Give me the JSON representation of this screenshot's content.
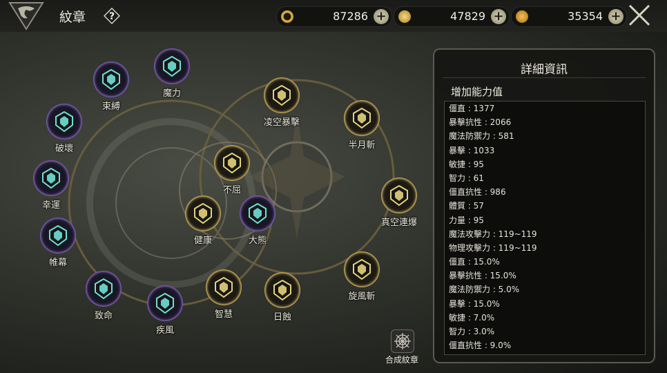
{
  "header": {
    "title": "紋章",
    "help_icon": "question-icon",
    "currencies": [
      {
        "name": "refresh-currency",
        "icon": "cycle-coin-icon",
        "value": "87286"
      },
      {
        "name": "gold-currency",
        "icon": "gold-coin-icon",
        "value": "47829"
      },
      {
        "name": "bronze-currency",
        "icon": "bronze-coin-icon",
        "value": "35354"
      }
    ],
    "close_icon": "crossed-swords-icon"
  },
  "emblems": [
    {
      "id": "shufu",
      "label": "束縛",
      "tier": "purple"
    },
    {
      "id": "moli",
      "label": "魔力",
      "tier": "purple"
    },
    {
      "id": "pohuai",
      "label": "破壞",
      "tier": "purple"
    },
    {
      "id": "xingyun",
      "label": "幸運",
      "tier": "purple"
    },
    {
      "id": "weimu",
      "label": "帷幕",
      "tier": "purple"
    },
    {
      "id": "zhiming",
      "label": "致命",
      "tier": "purple"
    },
    {
      "id": "jifeng",
      "label": "疾風",
      "tier": "purple"
    },
    {
      "id": "zhihui",
      "label": "智慧",
      "tier": "gold"
    },
    {
      "id": "rishi",
      "label": "日蝕",
      "tier": "gold"
    },
    {
      "id": "buqu",
      "label": "不屈",
      "tier": "gold"
    },
    {
      "id": "jiankang",
      "label": "健康",
      "tier": "gold"
    },
    {
      "id": "daxiong",
      "label": "大熊",
      "tier": "purple"
    },
    {
      "id": "lingkong",
      "label": "凌空暴擊",
      "tier": "gold"
    },
    {
      "id": "banyue",
      "label": "半月斬",
      "tier": "gold"
    },
    {
      "id": "zhenkong",
      "label": "真空連爆",
      "tier": "gold"
    },
    {
      "id": "xuanfeng",
      "label": "旋風斬",
      "tier": "gold"
    }
  ],
  "craft": {
    "label": "合成紋章",
    "icon": "cobweb-icon"
  },
  "panel": {
    "title": "詳細資訊",
    "subtitle": "增加能力值",
    "stats": [
      "僵直 : 1377",
      "暴擊抗性 : 2066",
      "魔法防禦力 : 581",
      "暴擊 : 1033",
      "敏捷 : 95",
      "智力 : 61",
      "僵直抗性 : 986",
      "體質 : 57",
      "力量 : 95",
      "魔法攻擊力 : 119~119",
      "物理攻擊力 : 119~119",
      "僵直 : 15.0%",
      "暴擊抗性 : 15.0%",
      "魔法防禦力 : 5.0%",
      "暴擊 : 15.0%",
      "敏捷 : 7.0%",
      "智力 : 3.0%",
      "僵直抗性 : 9.0%"
    ]
  },
  "colors": {
    "purple_ring": "#7b5fae",
    "gold_ring": "#c8aa5a",
    "teal_icon": "#6fe0d8",
    "gold_icon": "#e6d27a"
  }
}
